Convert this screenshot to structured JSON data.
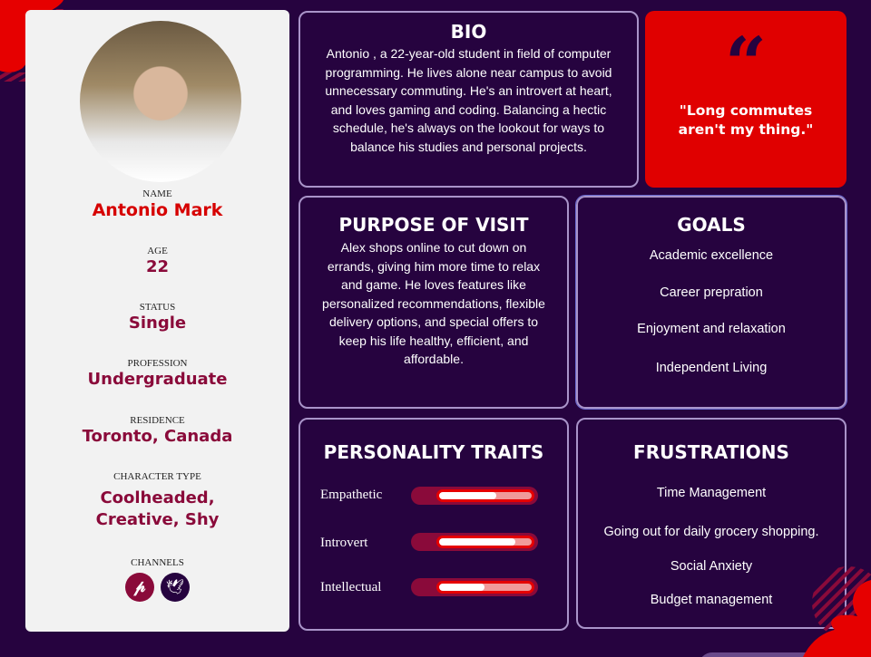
{
  "profile": {
    "name_label": "NAME",
    "name": "Antonio Mark",
    "age_label": "AGE",
    "age": "22",
    "status_label": "STATUS",
    "status": "Single",
    "profession_label": "PROFESSION",
    "profession": "Undergraduate",
    "residence_label": "RESIDENCE",
    "residence": "Toronto, Canada",
    "character_label": "CHARACTER TYPE",
    "character_line1": "Coolheaded,",
    "character_line2": "Creative, Shy",
    "channels_label": "CHANNELS",
    "channels": [
      {
        "icon": "pinterest-icon",
        "color": "#8a0a3a"
      },
      {
        "icon": "twitter-icon",
        "color": "#26033f"
      }
    ]
  },
  "bio": {
    "title": "BIO",
    "text": "Antonio , a 22-year-old student in field of computer programming. He lives alone near campus to avoid unnecessary commuting. He's an introvert at heart, and loves gaming and coding. Balancing a hectic schedule, he's always on the lookout for ways to balance his studies and personal projects."
  },
  "quote": {
    "icon": "quote-icon",
    "text": "\"Long commutes aren't my thing.\"",
    "color": "#e00000"
  },
  "purpose": {
    "title": "PURPOSE OF VISIT",
    "text": "Alex shops online to cut down on errands, giving him more time to relax and game. He loves features like personalized recommendations, flexible delivery options, and special offers to keep his life healthy, efficient, and affordable."
  },
  "goals": {
    "title": "GOALS",
    "items": [
      "Academic excellence",
      "Career prepration",
      "Enjoyment and relaxation",
      "Independent Living"
    ]
  },
  "traits": {
    "title": "PERSONALITY TRAITS",
    "items": [
      {
        "label": "Empathetic",
        "level": 0.62
      },
      {
        "label": "Introvert",
        "level": 0.82
      },
      {
        "label": "Intellectual",
        "level": 0.49
      }
    ]
  },
  "frustrations": {
    "title": "FRUSTRATIONS",
    "items": [
      "Time Management",
      "Going out for daily grocery shopping.",
      "Social Anxiety",
      "Budget management"
    ]
  }
}
